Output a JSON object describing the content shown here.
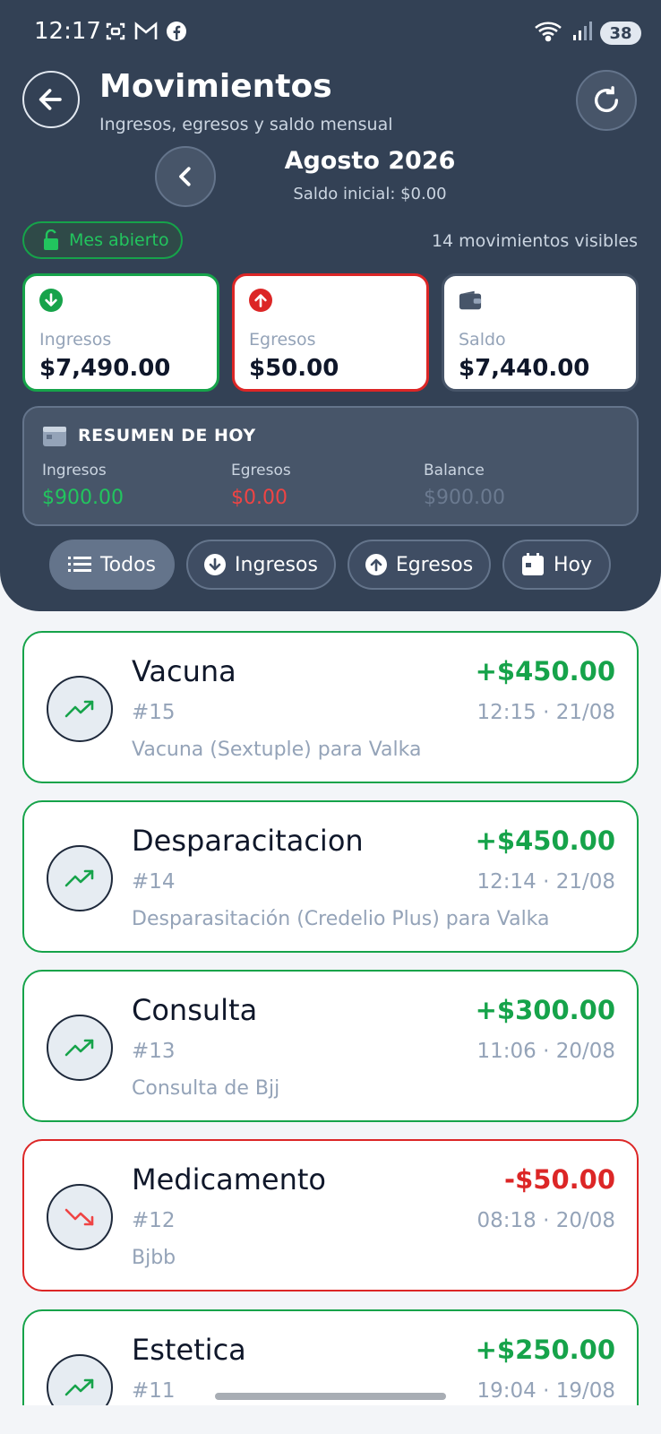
{
  "status_bar": {
    "time": "12:17",
    "battery": "38",
    "icons": [
      "screenshot-icon",
      "gmail-icon",
      "facebook-icon",
      "wifi-icon",
      "signal-icon"
    ]
  },
  "header": {
    "title": "Movimientos",
    "subtitle": "Ingresos, egresos y saldo mensual",
    "month": "Agosto 2026",
    "saldo_inicial": "Saldo inicial: $0.00",
    "status_label": "Mes abierto",
    "visible_count": "14 movimientos visibles"
  },
  "summary": {
    "ingresos": {
      "label": "Ingresos",
      "value": "$7,490.00"
    },
    "egresos": {
      "label": "Egresos",
      "value": "$50.00"
    },
    "saldo": {
      "label": "Saldo",
      "value": "$7,440.00"
    }
  },
  "today": {
    "title": "RESUMEN DE HOY",
    "ingresos_label": "Ingresos",
    "ingresos_value": "$900.00",
    "egresos_label": "Egresos",
    "egresos_value": "$0.00",
    "balance_label": "Balance",
    "balance_value": "$900.00"
  },
  "filters": {
    "todos": "Todos",
    "ingresos": "Ingresos",
    "egresos": "Egresos",
    "hoy": "Hoy",
    "active": "Todos"
  },
  "colors": {
    "header_bg": "#334155",
    "positive": "#16a34a",
    "negative": "#dc2626",
    "muted": "#94a3b8"
  },
  "movements": [
    {
      "name": "Vacuna",
      "amount": "+$450.00",
      "number": "#15",
      "time": "12:15 · 21/08",
      "description": "Vacuna (Sextuple) para Valka",
      "type": "income"
    },
    {
      "name": "Desparacitacion",
      "amount": "+$450.00",
      "number": "#14",
      "time": "12:14 · 21/08",
      "description": "Desparasitación (Credelio Plus) para Valka",
      "type": "income"
    },
    {
      "name": "Consulta",
      "amount": "+$300.00",
      "number": "#13",
      "time": "11:06 · 20/08",
      "description": "Consulta de Bjj",
      "type": "income"
    },
    {
      "name": "Medicamento",
      "amount": "-$50.00",
      "number": "#12",
      "time": "08:18 · 20/08",
      "description": "Bjbb",
      "type": "expense"
    },
    {
      "name": "Estetica",
      "amount": "+$250.00",
      "number": "#11",
      "time": "19:04 · 19/08",
      "description": "",
      "type": "income"
    }
  ]
}
